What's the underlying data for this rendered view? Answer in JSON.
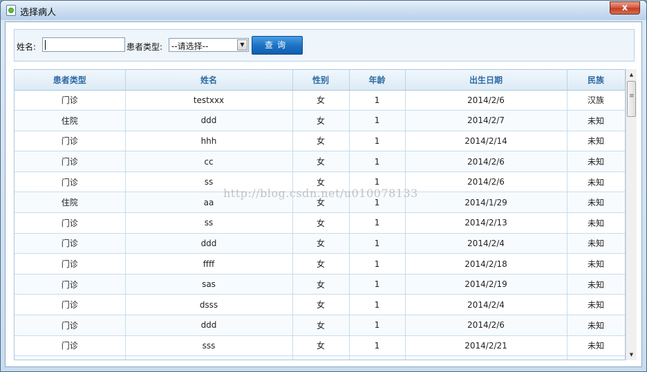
{
  "window": {
    "title": "选择病人",
    "close_label": "x"
  },
  "search": {
    "name_label": "姓名:",
    "name_value": "",
    "type_label": "患者类型:",
    "type_selected": "--请选择--",
    "query_button": "查询"
  },
  "table": {
    "columns": [
      "患者类型",
      "姓名",
      "性别",
      "年龄",
      "出生日期",
      "民族"
    ],
    "rows": [
      [
        "门诊",
        "testxxx",
        "女",
        "1",
        "2014/2/6",
        "汉族"
      ],
      [
        "住院",
        "ddd",
        "女",
        "1",
        "2014/2/7",
        "未知"
      ],
      [
        "门诊",
        "hhh",
        "女",
        "1",
        "2014/2/14",
        "未知"
      ],
      [
        "门诊",
        "cc",
        "女",
        "1",
        "2014/2/6",
        "未知"
      ],
      [
        "门诊",
        "ss",
        "女",
        "1",
        "2014/2/6",
        "未知"
      ],
      [
        "住院",
        "aa",
        "女",
        "1",
        "2014/1/29",
        "未知"
      ],
      [
        "门诊",
        "ss",
        "女",
        "1",
        "2014/2/13",
        "未知"
      ],
      [
        "门诊",
        "ddd",
        "女",
        "1",
        "2014/2/4",
        "未知"
      ],
      [
        "门诊",
        "ffff",
        "女",
        "1",
        "2014/2/18",
        "未知"
      ],
      [
        "门诊",
        "sas",
        "女",
        "1",
        "2014/2/19",
        "未知"
      ],
      [
        "门诊",
        "dsss",
        "女",
        "1",
        "2014/2/4",
        "未知"
      ],
      [
        "门诊",
        "ddd",
        "女",
        "1",
        "2014/2/6",
        "未知"
      ],
      [
        "门诊",
        "sss",
        "女",
        "1",
        "2014/2/21",
        "未知"
      ],
      [
        "",
        "",
        "",
        "",
        "",
        ""
      ]
    ]
  },
  "watermark": "http://blog.csdn.net/u010078133"
}
